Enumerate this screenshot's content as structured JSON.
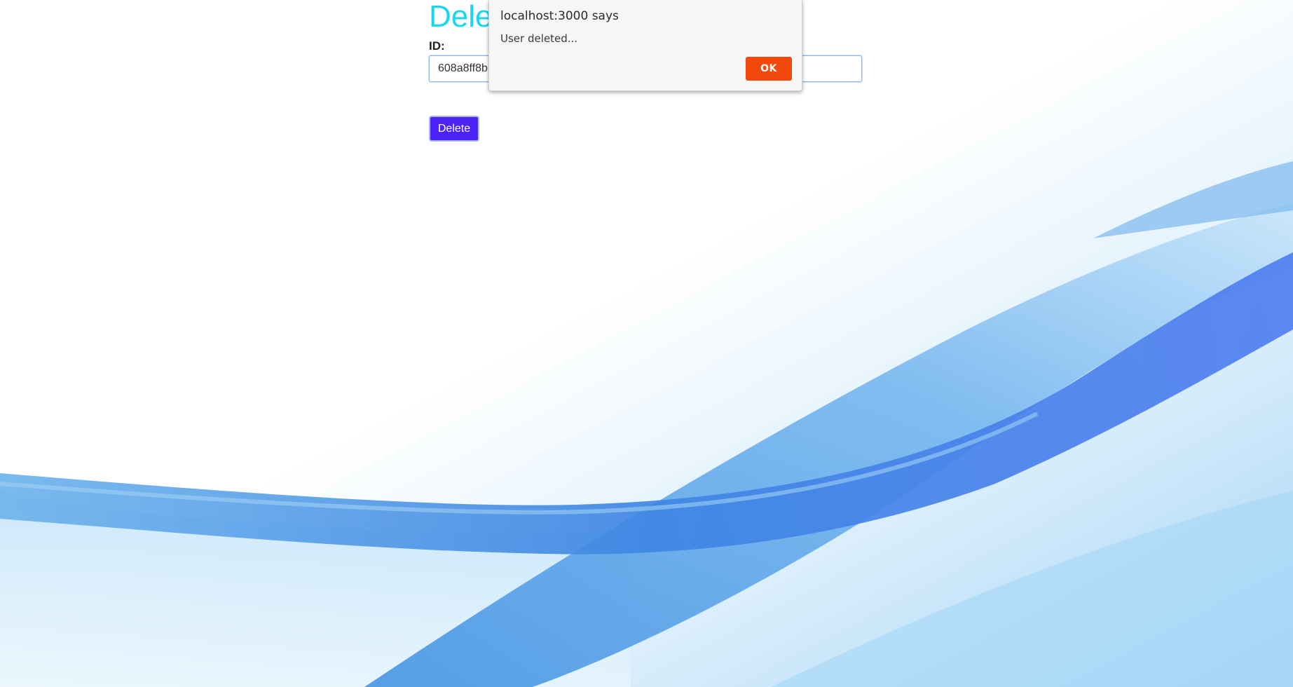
{
  "page": {
    "title": "Delete",
    "id_label": "ID:",
    "id_value": "608a8ff8b",
    "delete_button_label": "Delete"
  },
  "dialog": {
    "title": "localhost:3000 says",
    "message": "User deleted...",
    "ok_label": "OK"
  },
  "colors": {
    "title": "#19d6f2",
    "delete_button": "#4a23f5",
    "ok_button": "#f24a0c",
    "background_wave": "#4a8be8"
  }
}
